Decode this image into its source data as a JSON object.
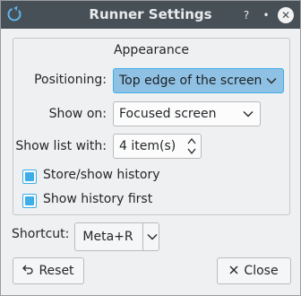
{
  "window": {
    "title": "Runner Settings",
    "buttons": {
      "help": "?",
      "minimize": "•",
      "maximize": "✕"
    }
  },
  "appearance": {
    "group_title": "Appearance",
    "positioning": {
      "label": "Positioning:",
      "value": "Top edge of the screen"
    },
    "show_on": {
      "label": "Show on:",
      "value": "Focused screen"
    },
    "show_list": {
      "label": "Show list with:",
      "value": "4 item(s)"
    },
    "store_history": {
      "label": "Store/show history",
      "checked": true
    },
    "history_first": {
      "label": "Show history first",
      "checked": true
    }
  },
  "shortcut": {
    "label": "Shortcut:",
    "value": "Meta+R"
  },
  "footer": {
    "reset_label": "Reset",
    "close_label": "Close"
  },
  "colors": {
    "titlebar": "#475057",
    "accent": "#3daee9",
    "highlight": "#8ec1e4"
  }
}
